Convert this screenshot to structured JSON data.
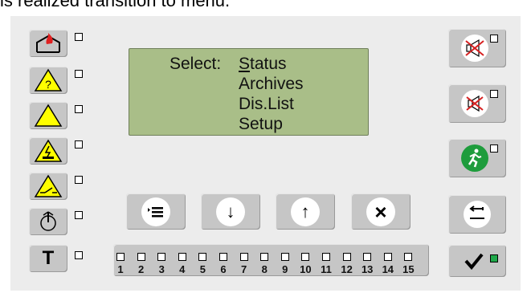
{
  "caption": "is realized transition to menu.",
  "lcd": {
    "prompt": "Select:",
    "items": [
      {
        "underlined_letter": "S",
        "rest": "tatus"
      },
      {
        "label": "Archives"
      },
      {
        "label": "Dis.List"
      },
      {
        "label": "Setup"
      }
    ]
  },
  "left_buttons": [
    {
      "name": "fire-alarm",
      "icon": "house-fire-icon"
    },
    {
      "name": "unknown-fault",
      "icon": "warning-question-icon"
    },
    {
      "name": "general-warning",
      "icon": "warning-triangle-icon"
    },
    {
      "name": "power-fault",
      "icon": "warning-lightning-icon"
    },
    {
      "name": "switch-fault",
      "icon": "warning-switch-icon"
    },
    {
      "name": "power-standby",
      "icon": "power-icon"
    },
    {
      "name": "test-mode",
      "label": "T"
    }
  ],
  "nav_buttons": {
    "menu": "≡",
    "down": "↓",
    "up": "↑",
    "cancel": "×"
  },
  "zones": {
    "numbers": [
      "1",
      "2",
      "3",
      "4",
      "5",
      "6",
      "7",
      "8",
      "9",
      "10",
      "11",
      "12",
      "13",
      "14",
      "15"
    ]
  },
  "right_buttons": [
    {
      "name": "silence-sounder",
      "icon": "speaker-mute-icon"
    },
    {
      "name": "silence-buzzer",
      "icon": "buzzer-mute-icon"
    },
    {
      "name": "evacuate",
      "icon": "running-man-icon"
    },
    {
      "name": "back",
      "icon": "return-arrow-icon"
    },
    {
      "name": "acknowledge",
      "icon": "checkmark-icon",
      "led_color": "#1fa84a"
    }
  ],
  "colors": {
    "lcd_background": "#a9be88",
    "warning_yellow": "#ffff00",
    "fire_red": "#e02020",
    "evacuate_green": "#1e9c3c",
    "mute_red": "#d62020",
    "ok_led_green": "#1fa84a"
  }
}
